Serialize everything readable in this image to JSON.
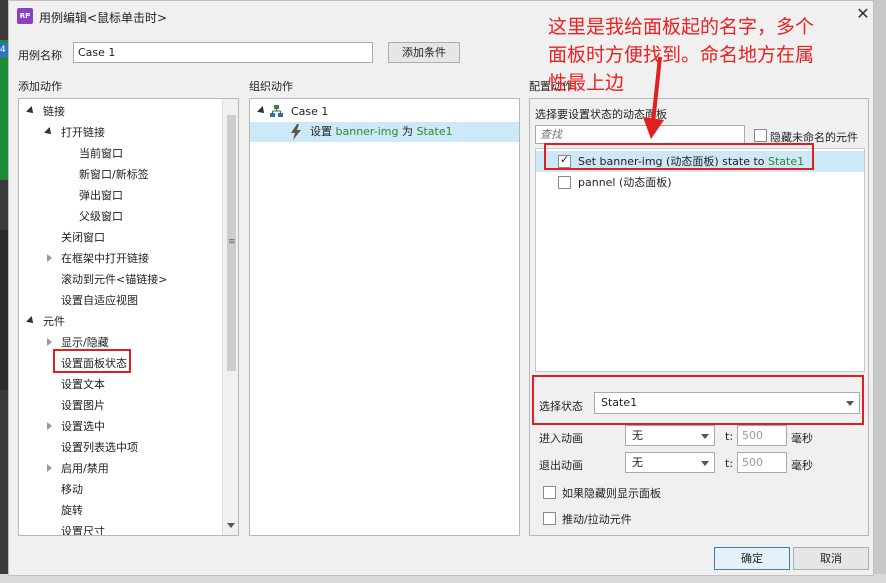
{
  "window": {
    "title": "用例编辑<鼠标单击时>",
    "icon_text": "RP"
  },
  "case_name": {
    "label": "用例名称",
    "value": "Case 1",
    "add_condition": "添加条件"
  },
  "sections": {
    "add_action": "添加动作",
    "organize_action": "组织动作",
    "config_action": "配置动作"
  },
  "actions_tree": {
    "links": "链接",
    "open_link": "打开链接",
    "current_window": "当前窗口",
    "new_tab": "新窗口/新标签",
    "popup": "弹出窗口",
    "parent_window": "父级窗口",
    "close_window": "关闭窗口",
    "open_in_frame": "在框架中打开链接",
    "scroll_to": "滚动到元件<锚链接>",
    "set_adaptive": "设置自适应视图",
    "widgets": "元件",
    "show_hide": "显示/隐藏",
    "set_panel_state": "设置面板状态",
    "set_text": "设置文本",
    "set_image": "设置图片",
    "set_selected": "设置选中",
    "set_list_selected": "设置列表选中项",
    "enable_disable": "启用/禁用",
    "move": "移动",
    "rotate": "旋转",
    "set_size": "设置尺寸"
  },
  "organize": {
    "case": "Case 1",
    "action_prefix": "设置 ",
    "action_target": "banner-img",
    "action_mid": " 为 ",
    "action_state": "State1"
  },
  "config": {
    "select_panel_label": "选择要设置状态的动态面板",
    "search_placeholder": "查找",
    "hide_unnamed": "隐藏未命名的元件",
    "panel_rows": [
      {
        "text": "Set banner-img (动态面板) state to ",
        "state": "State1",
        "checked": true
      },
      {
        "text": "pannel (动态面板)",
        "state": "",
        "checked": false
      }
    ],
    "select_state_label": "选择状态",
    "select_state_value": "State1",
    "enter_anim_label": "进入动画",
    "exit_anim_label": "退出动画",
    "anim_value": "无",
    "t_label": "t:",
    "duration": "500",
    "ms": "毫秒",
    "show_if_hidden": "如果隐藏则显示面板",
    "push_pull": "推动/拉动元件"
  },
  "footer": {
    "ok": "确定",
    "cancel": "取消"
  },
  "annotation": {
    "line1": "这里是我给面板起的名字，多个",
    "line2": "面板时方便找到。命名地方在属",
    "line3": "性最上边"
  },
  "bg": {
    "left_badge": "4"
  }
}
